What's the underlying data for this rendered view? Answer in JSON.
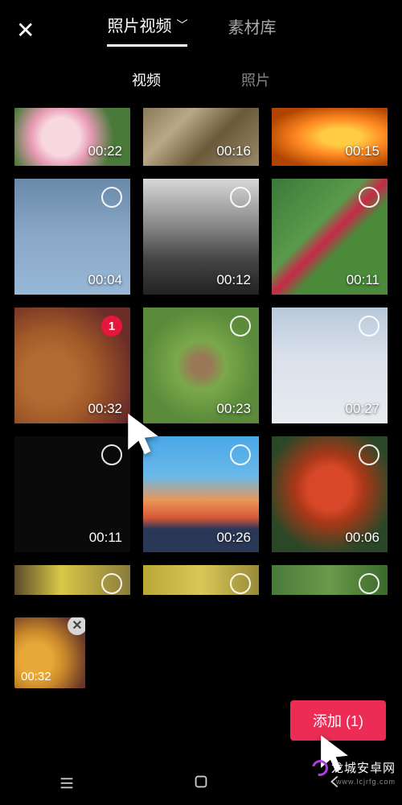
{
  "header": {
    "tab_photo_video": "照片视频",
    "tab_library": "素材库"
  },
  "subtabs": {
    "video": "视频",
    "photo": "照片"
  },
  "grid": {
    "items": [
      {
        "duration": "00:22",
        "thumb": "g-pink",
        "short": true,
        "no_ring": true
      },
      {
        "duration": "00:16",
        "thumb": "g-reeds",
        "short": true,
        "no_ring": true
      },
      {
        "duration": "00:15",
        "thumb": "g-fire",
        "short": true,
        "no_ring": true
      },
      {
        "duration": "00:04",
        "thumb": "g-wind"
      },
      {
        "duration": "00:12",
        "thumb": "g-mtn"
      },
      {
        "duration": "00:11",
        "thumb": "g-flowers"
      },
      {
        "duration": "00:32",
        "thumb": "g-butterfly",
        "selected": true,
        "badge": "1"
      },
      {
        "duration": "00:23",
        "thumb": "g-bird"
      },
      {
        "duration": "00:27",
        "thumb": "g-snow"
      },
      {
        "duration": "00:11",
        "thumb": "g-black"
      },
      {
        "duration": "00:26",
        "thumb": "g-sunset"
      },
      {
        "duration": "00:06",
        "thumb": "g-rose"
      },
      {
        "duration": "",
        "thumb": "g-yel1",
        "tiny": true
      },
      {
        "duration": "",
        "thumb": "g-yel2",
        "tiny": true
      },
      {
        "duration": "",
        "thumb": "g-grn",
        "tiny": true
      }
    ]
  },
  "selected": {
    "items": [
      {
        "duration": "00:32",
        "thumb": "g-butterfly"
      }
    ]
  },
  "buttons": {
    "add_label": "添加 (1)"
  },
  "watermark": {
    "line1": "龙城安卓网",
    "line2": "www.lcjrfg.com"
  }
}
